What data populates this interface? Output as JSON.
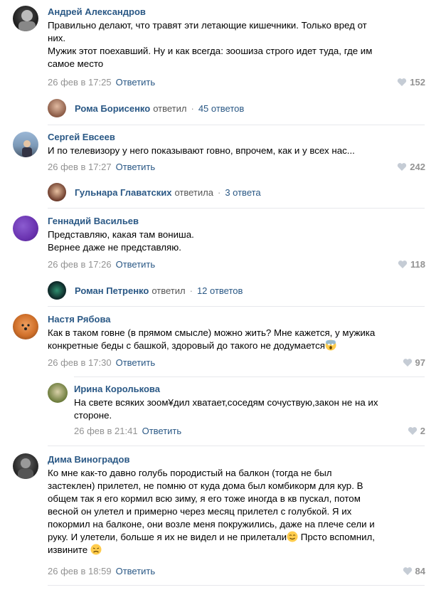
{
  "comments": [
    {
      "author": "Андрей Александров",
      "lines": [
        "Правильно делают, что травят эти летающие кишечники. Только вред от",
        "них.",
        "Мужик этот поехавший. Ну и как всегда: зоошиза строго идет туда, где им",
        "самое место"
      ],
      "date": "26 фев в 17:25",
      "reply": "Ответить",
      "likes": "152",
      "thread": {
        "name": "Рома Борисенко",
        "verb": "ответил",
        "count": "45 ответов"
      }
    },
    {
      "author": "Сергей Евсеев",
      "lines": [
        "И по телевизору у него показывают говно, впрочем, как и у всех нас..."
      ],
      "date": "26 фев в 17:27",
      "reply": "Ответить",
      "likes": "242",
      "thread": {
        "name": "Гульнара Главатских",
        "verb": "ответила",
        "count": "3 ответа"
      }
    },
    {
      "author": "Геннадий Васильев",
      "lines": [
        "Представляю, какая там вониша.",
        "Вернее даже не представляю."
      ],
      "date": "26 фев в 17:26",
      "reply": "Ответить",
      "likes": "118",
      "thread": {
        "name": "Роман Петренко",
        "verb": "ответил",
        "count": "12 ответов"
      }
    },
    {
      "author": "Настя Рябова",
      "lines": [
        "Как в таком говне (в прямом смысле) можно жить? Мне кажется, у мужика",
        "конкретные беды с башкой, здоровый до такого не додумается"
      ],
      "date": "26 фев в 17:30",
      "reply": "Ответить",
      "likes": "97"
    },
    {
      "author": "Ирина Королькова",
      "lines": [
        "На свете всяких зоом¥дил хватает,соседям сочуствую,закон не на их",
        "стороне."
      ],
      "date": "26 фев в 21:41",
      "reply": "Ответить",
      "likes": "2"
    },
    {
      "author": "Дима Виноградов",
      "lines": [
        "Ко мне как-то давно голубь породистый на балкон (тогда не был",
        "застеклен) прилетел, не помню от куда дома был комбикорм для кур. В",
        "общем так я его кормил всю зиму, я его тоже иногда в кв пускал, потом",
        "весной он улетел и примерно через месяц прилетел с голубкой. Я их",
        "покормил на балконе, они возле меня покружились, даже на плече сели и",
        "руку. И улетели, больше я их не видел и не прилетали",
        "извините"
      ],
      "tail_text": "Прсто вспомнил,",
      "date": "26 фев в 18:59",
      "reply": "Ответить",
      "likes": "84"
    }
  ],
  "colors": {
    "link": "#2a5885",
    "meta": "#939393",
    "separator": "#e7e8ec"
  }
}
